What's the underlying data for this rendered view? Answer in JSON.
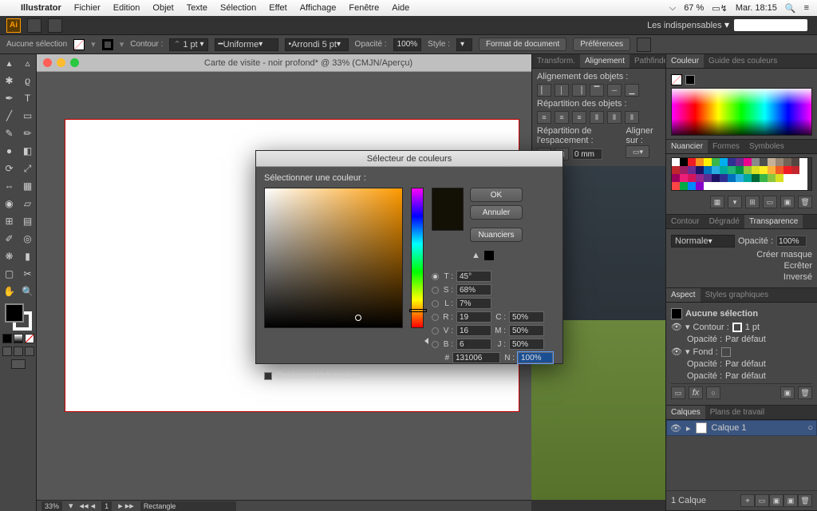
{
  "menubar": {
    "app": "Illustrator",
    "items": [
      "Fichier",
      "Edition",
      "Objet",
      "Texte",
      "Sélection",
      "Effet",
      "Affichage",
      "Fenêtre",
      "Aide"
    ],
    "battery": "67 %",
    "clock": "Mar. 18:15"
  },
  "workspace": "Les indispensables",
  "control": {
    "no_selection": "Aucune sélection",
    "stroke_label": "Contour :",
    "stroke_val": "1 pt",
    "stroke_style": "Uniforme",
    "cap": "Arrondi 5 pt",
    "opacity_label": "Opacité :",
    "opacity_val": "100%",
    "style_label": "Style :",
    "doc_format": "Format de document",
    "prefs": "Préférences"
  },
  "document": {
    "title": "Carte de visite - noir profond* @ 33% (CMJN/Aperçu)"
  },
  "status": {
    "zoom": "33%",
    "page": "1",
    "tool": "Rectangle"
  },
  "mid_panel": {
    "tabs": [
      "Transform.",
      "Alignement",
      "Pathfinder"
    ],
    "heading1": "Alignement des objets :",
    "heading2": "Répartition des objets :",
    "heading3": "Répartition de l'espacement :",
    "heading4": "Aligner sur :",
    "spacing_val": "0 mm"
  },
  "color_panel": {
    "tabs": [
      "Couleur",
      "Guide des couleurs"
    ]
  },
  "swatch_panel": {
    "tabs": [
      "Nuancier",
      "Formes",
      "Symboles"
    ]
  },
  "stroke_panel": {
    "tabs": [
      "Contour",
      "Dégradé",
      "Transparence"
    ],
    "blend": "Normale",
    "opacity_label": "Opacité :",
    "opacity_val": "100%",
    "mask_create": "Créer masque",
    "mask_clip": "Ecrêter",
    "mask_invert": "Inversé"
  },
  "aspect_panel": {
    "tabs": [
      "Aspect",
      "Styles graphiques"
    ],
    "no_sel": "Aucune sélection",
    "contour": "Contour :",
    "contour_val": "1 pt",
    "fond": "Fond :",
    "op_label": "Opacité :",
    "op_val": "Par défaut"
  },
  "layers_panel": {
    "tabs": [
      "Calques",
      "Plans de travail"
    ],
    "layer1": "Calque 1",
    "count": "1 Calque"
  },
  "dialog": {
    "title": "Sélecteur de couleurs",
    "select_label": "Sélectionner une couleur :",
    "ok": "OK",
    "cancel": "Annuler",
    "swatches": "Nuanciers",
    "web_only": "Couleurs Web seules",
    "T": "45°",
    "S": "68%",
    "L": "7%",
    "R": "19",
    "V": "16",
    "B": "6",
    "C": "50%",
    "M": "50%",
    "J": "50%",
    "N": "100%",
    "hex": "131006"
  },
  "swatch_colors": [
    "#ffffff",
    "#000000",
    "#ed1c24",
    "#f7941e",
    "#fff200",
    "#39b54a",
    "#00aeef",
    "#2e3192",
    "#662d91",
    "#ec008c",
    "#898989",
    "#4d4d4d",
    "#c7b299",
    "#998675",
    "#736357",
    "#534741",
    "#ffffff",
    "#c0272d",
    "#9e1f63",
    "#6b2c91",
    "#1b1464",
    "#0071bc",
    "#29abe2",
    "#00a99d",
    "#22b573",
    "#009245",
    "#8cc63f",
    "#d9e021",
    "#fcee21",
    "#fbb03b",
    "#f15a24",
    "#ed1c24",
    "#c1272d",
    "#ffffff",
    "#9e005d",
    "#ed1e79",
    "#d4145a",
    "#93278f",
    "#5b2d90",
    "#1b1464",
    "#2e3192",
    "#0071bc",
    "#29abe2",
    "#00a99d",
    "#006837",
    "#39b54a",
    "#8cc63f",
    "#d9e021",
    "#ffffff",
    "#ffffff",
    "#ffffff",
    "#f44",
    "#0a4",
    "#08f",
    "#80c",
    "#ffffff",
    "#ffffff",
    "#ffffff",
    "#ffffff",
    "#ffffff",
    "#ffffff",
    "#ffffff",
    "#ffffff",
    "#ffffff",
    "#ffffff",
    "#ffffff",
    "#ffffff",
    "#ffffff"
  ]
}
